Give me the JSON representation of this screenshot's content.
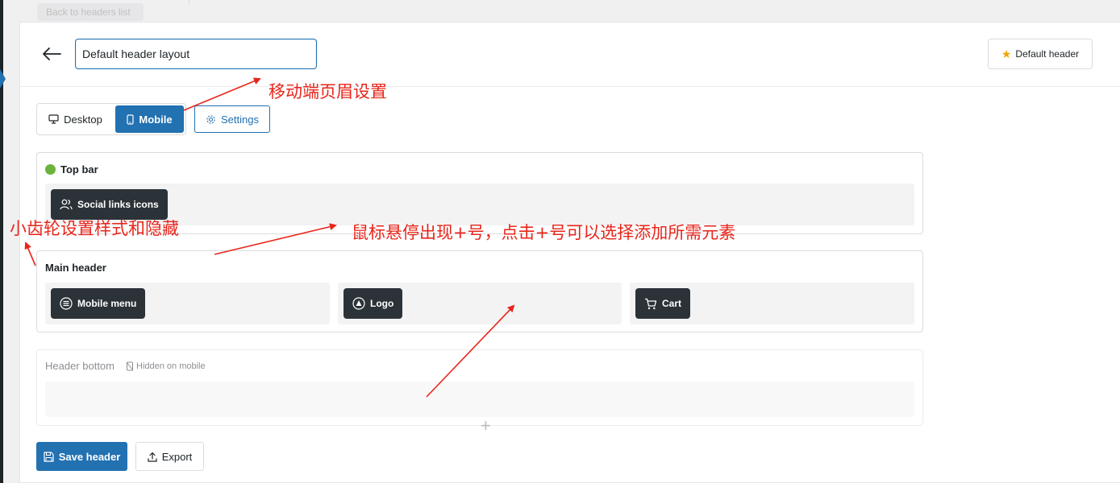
{
  "top": {
    "back_link": "Back to headers list"
  },
  "header": {
    "title_value": "Default header layout",
    "default_button": "Default header"
  },
  "tabs": {
    "desktop": "Desktop",
    "mobile": "Mobile",
    "settings": "Settings"
  },
  "rows": {
    "top_bar": {
      "title": "Top bar",
      "elements": [
        "Social links icons"
      ]
    },
    "main_header": {
      "title": "Main header",
      "elements": [
        "Mobile menu",
        "Logo",
        "Cart"
      ]
    },
    "header_bottom": {
      "title": "Header bottom",
      "hidden_label": "Hidden on mobile",
      "add_symbol": "+"
    }
  },
  "actions": {
    "save": "Save header",
    "export": "Export"
  },
  "annotations": {
    "mobile_settings": "移动端页眉设置",
    "gear_settings": "小齿轮设置样式和隐藏",
    "hover_add": "鼠标悬停出现+号，点击+号可以选择添加所需元素"
  },
  "colors": {
    "accent": "#2271b1",
    "chip": "#2c3338",
    "annotation": "#e8251b",
    "status_dot": "#6bb33a",
    "star": "#f0a400"
  }
}
